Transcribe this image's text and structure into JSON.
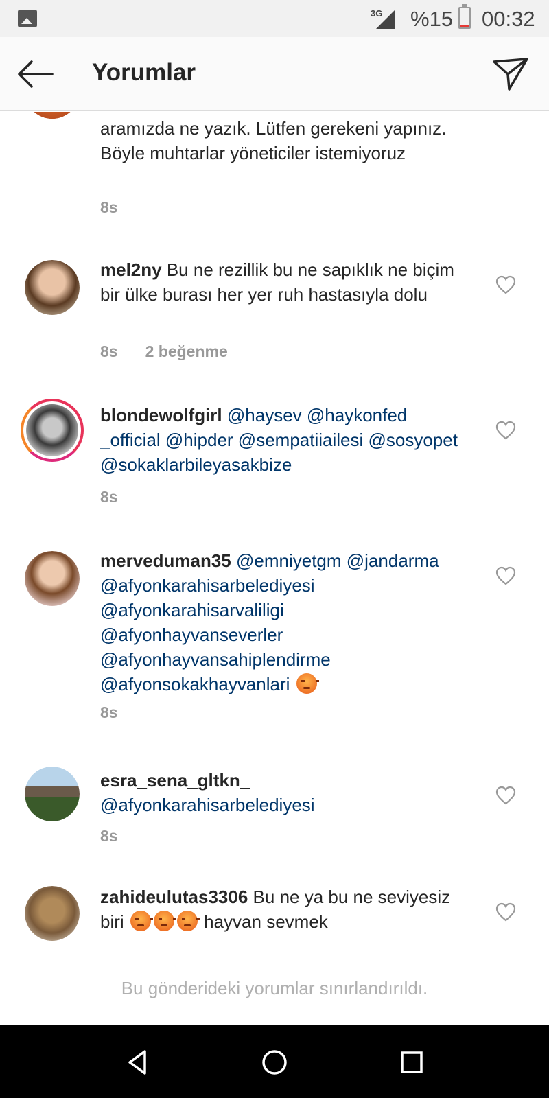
{
  "status_bar": {
    "network": "3G",
    "battery_text": "%15",
    "battery_level": 0.15,
    "time": "00:32",
    "colors": {
      "battery_low": "#e53935"
    }
  },
  "header": {
    "title": "Yorumlar",
    "back_icon": "arrow-left-icon",
    "send_icon": "paper-plane-icon"
  },
  "comments": [
    {
      "username": "",
      "text": "aramızda ne yazık. Lütfen gerekeni yapınız. Böyle muhtarlar yöneticiler istemiyoruz",
      "time": "8s"
    },
    {
      "username": "mel2ny",
      "text": "Bu ne rezillik bu ne sapıklık ne biçim bir ülke burası her yer ruh hastasıyla dolu",
      "time": "8s",
      "likes": "2 beğenme"
    },
    {
      "username": "blondewolfgirl",
      "text": "@haysev @haykonfed _official @hipder @sempatiiailesi @sosyopet @sokaklarbileyasakbize",
      "time": "8s"
    },
    {
      "username": "merveduman35",
      "text": "@emniyetgm @jandarma @afyonkarahisarbelediyesi @afyonkarahisarvaliligi @afyonhayvanseverler @afyonhayvansahiplendirme @afyonsokakhayvanlari",
      "time": "8s"
    },
    {
      "username": "esra_sena_gltkn_",
      "text": "@afyonkarahisarbelediyesi",
      "time": "8s"
    },
    {
      "username": "zahideulutas3306",
      "text_a": "Bu ne ya bu ne seviyesiz biri",
      "text_b": "hayvan sevmek"
    }
  ],
  "footer": {
    "restriction_text": "Bu gönderideki yorumlar sınırlandırıldı."
  },
  "nav": {
    "back_icon": "triangle-back-icon",
    "home_icon": "circle-home-icon",
    "recents_icon": "square-recents-icon"
  }
}
